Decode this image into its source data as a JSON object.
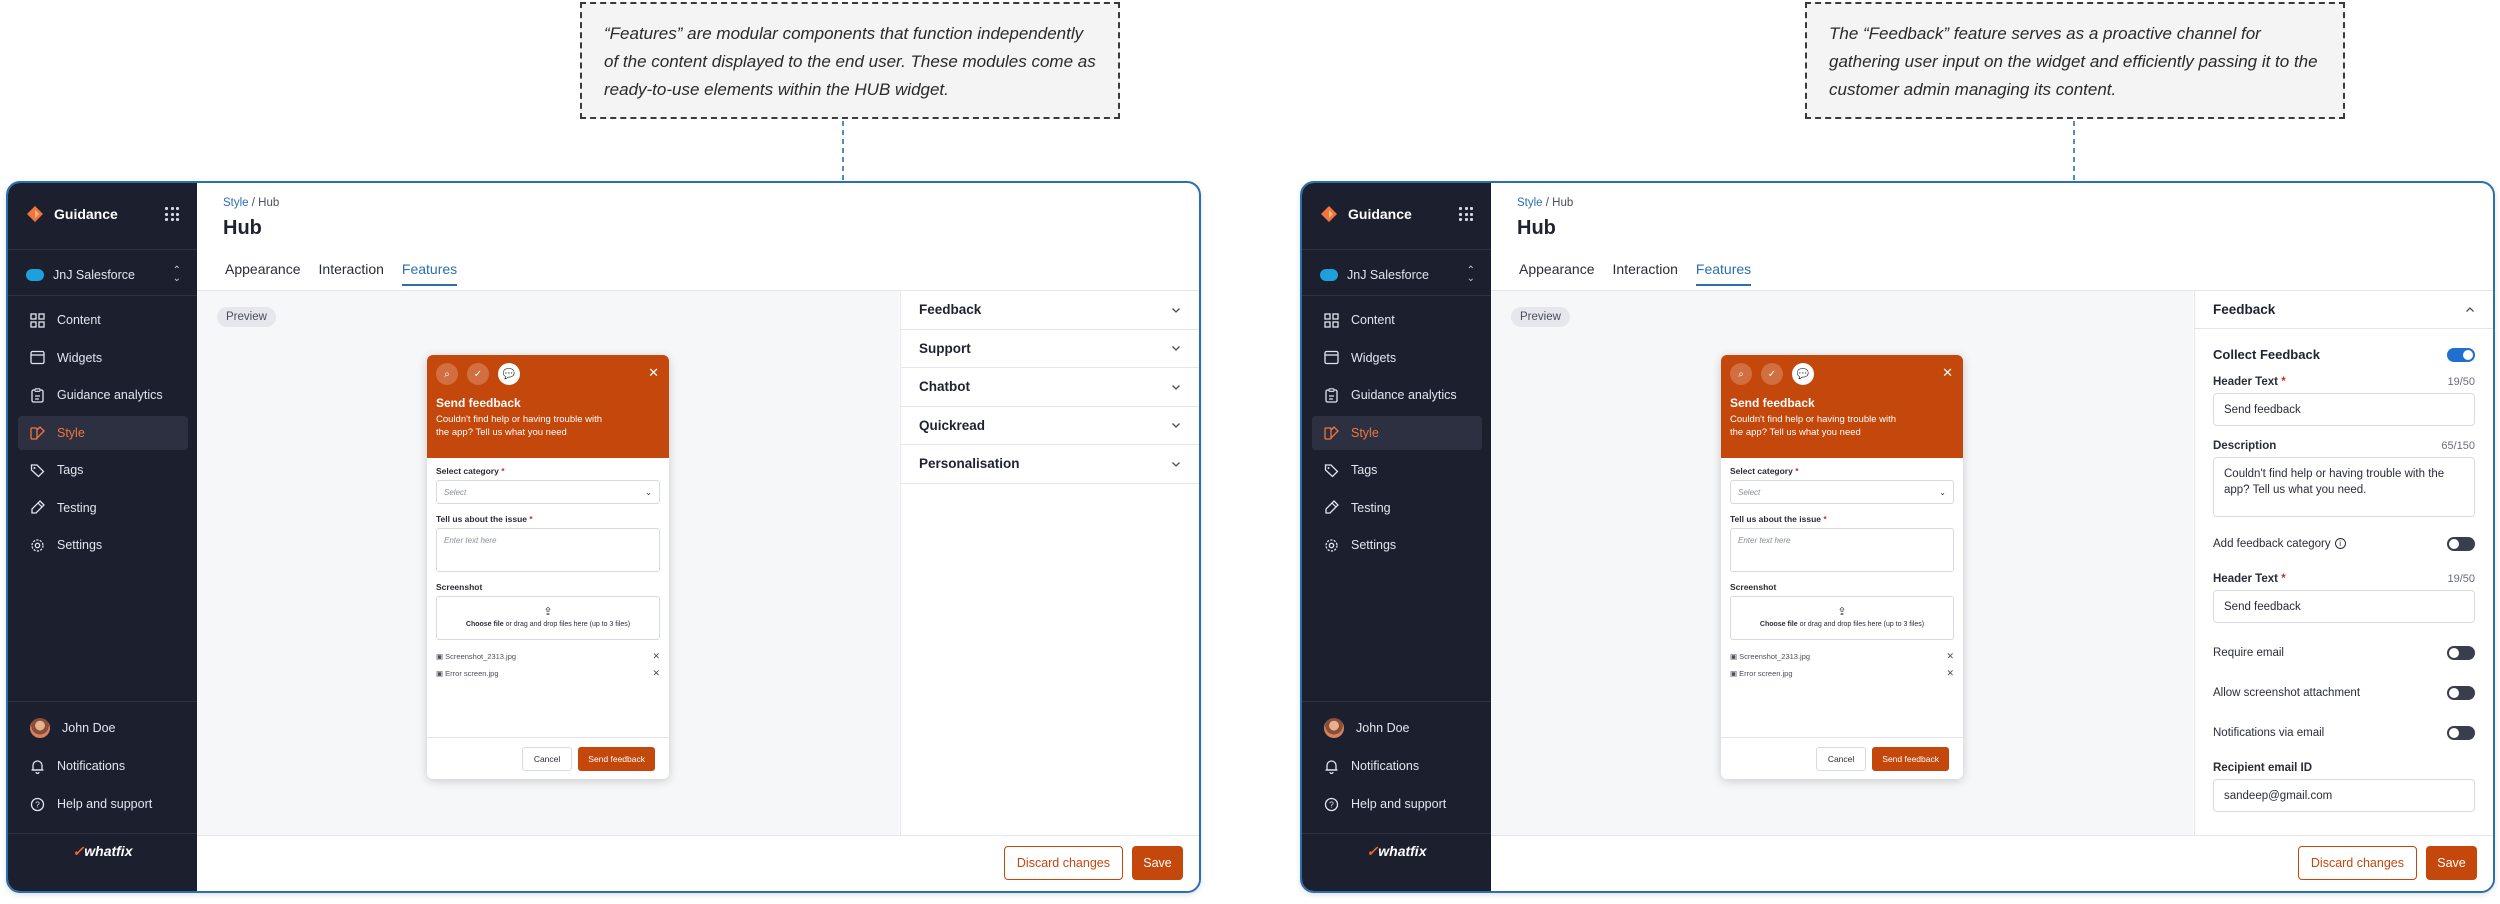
{
  "callouts": {
    "left": [
      "“Features” are modular components that function independently",
      "of the content displayed to the end user. These modules come as",
      "ready-to-use elements within the HUB widget."
    ],
    "right": [
      "The “Feedback” feature serves as a proactive channel for",
      "gathering user input on the widget and efficiently passing it to the",
      "customer admin managing its content."
    ]
  },
  "sidebar": {
    "brand": "Guidance",
    "account": "JnJ Salesforce",
    "nav": [
      {
        "label": "Content",
        "icon": "content-icon"
      },
      {
        "label": "Widgets",
        "icon": "widgets-icon"
      },
      {
        "label": "Guidance analytics",
        "icon": "analytics-icon"
      },
      {
        "label": "Style",
        "icon": "style-icon",
        "active": true
      },
      {
        "label": "Tags",
        "icon": "tag-icon"
      },
      {
        "label": "Testing",
        "icon": "testing-icon"
      },
      {
        "label": "Settings",
        "icon": "gear-icon"
      }
    ],
    "user": "John Doe",
    "notifications": "Notifications",
    "help": "Help and support",
    "logo": "whatfix"
  },
  "header": {
    "crumb_link": "Style",
    "crumb_sep": " / ",
    "crumb_current": "Hub",
    "title": "Hub",
    "tabs": [
      "Appearance",
      "Interaction",
      "Features"
    ],
    "active_tab": "Features"
  },
  "preview": {
    "pill": "Preview",
    "widget": {
      "title": "Send feedback",
      "desc": "Couldn't find help or having trouble with the app? Tell us what you need",
      "category_label": "Select category",
      "category_placeholder": "Select",
      "issue_label": "Tell us about the issue",
      "issue_placeholder": "Enter text here",
      "screenshot_label": "Screenshot",
      "upload_bold": "Choose file",
      "upload_rest": " or drag and drop files here (up to 3 files)",
      "files": [
        "Screenshot_2313.jpg",
        "Error screen.jpg"
      ],
      "cancel": "Cancel",
      "send": "Send feedback"
    }
  },
  "features": [
    "Feedback",
    "Support",
    "Chatbot",
    "Quickread",
    "Personalisation"
  ],
  "feedback_panel": {
    "title": "Feedback",
    "collect": "Collect Feedback",
    "header_text_label": "Header Text",
    "header_text_count": "19/50",
    "header_text_value": "Send feedback",
    "description_label": "Description",
    "description_count": "65/150",
    "description_value": "Couldn't find help or having trouble with the app? Tell us what you need.",
    "add_category": "Add feedback category",
    "header_text2_label": "Header Text",
    "header_text2_count": "19/50",
    "header_text2_value": "Send feedback",
    "require_email": "Require email",
    "allow_screenshot": "Allow screenshot attachment",
    "notify_email": "Notifications via email",
    "recipient_label": "Recipient email ID",
    "recipient_value": "sandeep@gmail.com"
  },
  "footer": {
    "discard": "Discard changes",
    "save": "Save"
  },
  "colors": {
    "accent": "#c4470c",
    "link": "#2a6fb0",
    "sidebar": "#1c1f2e",
    "toggle_on": "#1f6fd1"
  }
}
